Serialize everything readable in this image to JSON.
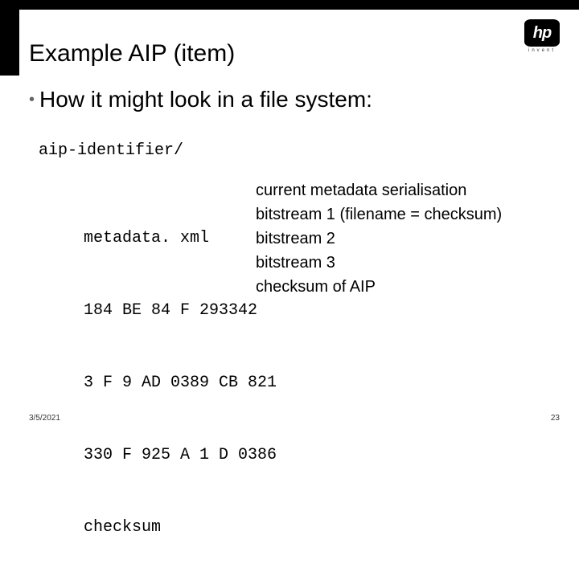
{
  "logo": {
    "mark": "hp",
    "text": "invent"
  },
  "title": "Example AIP (item)",
  "bullet": "How it might look in a file system:",
  "dir": "aip-identifier/",
  "files": [
    {
      "name": "metadata. xml",
      "desc": "current metadata serialisation"
    },
    {
      "name": "184 BE 84 F 293342",
      "desc": "bitstream 1 (filename = checksum)"
    },
    {
      "name": "3 F 9 AD 0389 CB 821",
      "desc": "bitstream 2"
    },
    {
      "name": "330 F 925 A 1 D 0386",
      "desc": "bitstream 3"
    },
    {
      "name": "checksum",
      "desc": "checksum of AIP"
    }
  ],
  "footer": {
    "date": "3/5/2021",
    "page": "23"
  }
}
